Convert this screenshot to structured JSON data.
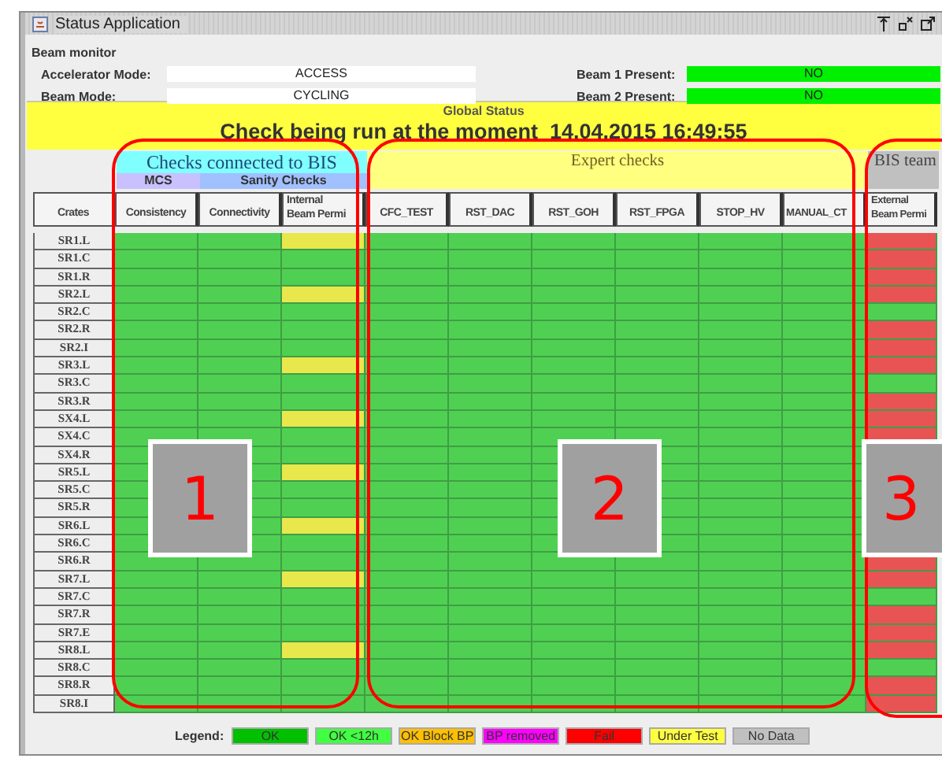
{
  "window": {
    "title": "Status Application"
  },
  "beam_monitor": {
    "title": "Beam monitor",
    "fields": [
      {
        "label": "Accelerator Mode:",
        "value": "ACCESS",
        "kind": "text"
      },
      {
        "label": "Beam Mode:",
        "value": "CYCLING",
        "kind": "text"
      },
      {
        "label": "Beam 1 Present:",
        "value": "NO",
        "kind": "indicator",
        "color": "#00f000"
      },
      {
        "label": "Beam 2 Present:",
        "value": "NO",
        "kind": "indicator",
        "color": "#00f000"
      }
    ]
  },
  "global_status": {
    "title": "Global Status",
    "message": "Check being run at the moment  14.04.2015 16:49:55"
  },
  "table": {
    "groups": [
      {
        "label": "Checks connected to BIS",
        "kind": "bis",
        "subgroups": [
          "MCS",
          "Sanity  Checks"
        ]
      },
      {
        "label": "Expert  checks",
        "kind": "expert"
      },
      {
        "label": "BIS team",
        "kind": "team"
      }
    ],
    "columns": [
      "Crates",
      "Consistency",
      "Connectivity",
      "Internal\nBeam Permi",
      "CFC_TEST",
      "RST_DAC",
      "RST_GOH",
      "RST_FPGA",
      "STOP_HV",
      "MANUAL_CT",
      "External\nBeam Permi"
    ],
    "rows": [
      {
        "crate": "SR1.L",
        "cells": [
          {
            "color": "#50d052"
          },
          {
            "color": "#50d052"
          },
          {
            "color": "#e8e84c"
          },
          {
            "color": "#50d052"
          },
          {
            "color": "#50d052"
          },
          {
            "color": "#50d052"
          },
          {
            "color": "#50d052"
          },
          {
            "color": "#50d052"
          },
          {
            "color": "#50d052"
          },
          {
            "color": "#e85454"
          }
        ]
      },
      {
        "crate": "SR1.C",
        "cells": [
          {
            "color": "#50d052"
          },
          {
            "color": "#50d052"
          },
          {
            "color": "#50d052"
          },
          {
            "color": "#50d052"
          },
          {
            "color": "#50d052"
          },
          {
            "color": "#50d052"
          },
          {
            "color": "#50d052"
          },
          {
            "color": "#50d052"
          },
          {
            "color": "#50d052"
          },
          {
            "color": "#e85454"
          }
        ]
      },
      {
        "crate": "SR1.R",
        "cells": [
          {
            "color": "#50d052"
          },
          {
            "color": "#50d052"
          },
          {
            "color": "#50d052"
          },
          {
            "color": "#50d052"
          },
          {
            "color": "#50d052"
          },
          {
            "color": "#50d052"
          },
          {
            "color": "#50d052"
          },
          {
            "color": "#50d052"
          },
          {
            "color": "#50d052"
          },
          {
            "color": "#e85454"
          }
        ]
      },
      {
        "crate": "SR2.L",
        "cells": [
          {
            "color": "#50d052"
          },
          {
            "color": "#50d052"
          },
          {
            "color": "#e8e84c"
          },
          {
            "color": "#50d052"
          },
          {
            "color": "#50d052"
          },
          {
            "color": "#50d052"
          },
          {
            "color": "#50d052"
          },
          {
            "color": "#50d052"
          },
          {
            "color": "#50d052"
          },
          {
            "color": "#e85454"
          }
        ]
      },
      {
        "crate": "SR2.C",
        "cells": [
          {
            "color": "#50d052"
          },
          {
            "color": "#50d052"
          },
          {
            "color": "#50d052"
          },
          {
            "color": "#50d052"
          },
          {
            "color": "#50d052"
          },
          {
            "color": "#50d052"
          },
          {
            "color": "#50d052"
          },
          {
            "color": "#50d052"
          },
          {
            "color": "#50d052"
          },
          {
            "color": "#50d052"
          }
        ]
      },
      {
        "crate": "SR2.R",
        "cells": [
          {
            "color": "#50d052"
          },
          {
            "color": "#50d052"
          },
          {
            "color": "#50d052"
          },
          {
            "color": "#50d052"
          },
          {
            "color": "#50d052"
          },
          {
            "color": "#50d052"
          },
          {
            "color": "#50d052"
          },
          {
            "color": "#50d052"
          },
          {
            "color": "#50d052"
          },
          {
            "color": "#e85454"
          }
        ]
      },
      {
        "crate": "SR2.I",
        "cells": [
          {
            "color": "#50d052"
          },
          {
            "color": "#50d052"
          },
          {
            "color": "#50d052"
          },
          {
            "color": "#50d052"
          },
          {
            "color": "#50d052"
          },
          {
            "color": "#50d052"
          },
          {
            "color": "#50d052"
          },
          {
            "color": "#50d052"
          },
          {
            "color": "#50d052"
          },
          {
            "color": "#e85454"
          }
        ]
      },
      {
        "crate": "SR3.L",
        "cells": [
          {
            "color": "#50d052"
          },
          {
            "color": "#50d052"
          },
          {
            "color": "#e8e84c"
          },
          {
            "color": "#50d052"
          },
          {
            "color": "#50d052"
          },
          {
            "color": "#50d052"
          },
          {
            "color": "#50d052"
          },
          {
            "color": "#50d052"
          },
          {
            "color": "#50d052"
          },
          {
            "color": "#e85454"
          }
        ]
      },
      {
        "crate": "SR3.C",
        "cells": [
          {
            "color": "#50d052"
          },
          {
            "color": "#50d052"
          },
          {
            "color": "#50d052"
          },
          {
            "color": "#50d052"
          },
          {
            "color": "#50d052"
          },
          {
            "color": "#50d052"
          },
          {
            "color": "#50d052"
          },
          {
            "color": "#50d052"
          },
          {
            "color": "#50d052"
          },
          {
            "color": "#50d052"
          }
        ]
      },
      {
        "crate": "SR3.R",
        "cells": [
          {
            "color": "#50d052"
          },
          {
            "color": "#50d052"
          },
          {
            "color": "#50d052"
          },
          {
            "color": "#50d052"
          },
          {
            "color": "#50d052"
          },
          {
            "color": "#50d052"
          },
          {
            "color": "#50d052"
          },
          {
            "color": "#50d052"
          },
          {
            "color": "#50d052"
          },
          {
            "color": "#e85454"
          }
        ]
      },
      {
        "crate": "SX4.L",
        "cells": [
          {
            "color": "#50d052"
          },
          {
            "color": "#50d052"
          },
          {
            "color": "#e8e84c"
          },
          {
            "color": "#50d052"
          },
          {
            "color": "#50d052"
          },
          {
            "color": "#50d052"
          },
          {
            "color": "#50d052"
          },
          {
            "color": "#50d052"
          },
          {
            "color": "#50d052"
          },
          {
            "color": "#e85454"
          }
        ]
      },
      {
        "crate": "SX4.C",
        "cells": [
          {
            "color": "#50d052"
          },
          {
            "color": "#50d052"
          },
          {
            "color": "#50d052"
          },
          {
            "color": "#50d052"
          },
          {
            "color": "#50d052"
          },
          {
            "color": "#50d052"
          },
          {
            "color": "#50d052"
          },
          {
            "color": "#50d052"
          },
          {
            "color": "#50d052"
          },
          {
            "color": "#e85454"
          }
        ]
      },
      {
        "crate": "SX4.R",
        "cells": [
          {
            "color": "#50d052"
          },
          {
            "color": "#50d052"
          },
          {
            "color": "#50d052"
          },
          {
            "color": "#50d052"
          },
          {
            "color": "#50d052"
          },
          {
            "color": "#50d052"
          },
          {
            "color": "#50d052"
          },
          {
            "color": "#50d052"
          },
          {
            "color": "#50d052"
          },
          null
        ]
      },
      {
        "crate": "SR5.L",
        "cells": [
          {
            "color": "#50d052"
          },
          {
            "color": "#50d052"
          },
          {
            "color": "#e8e84c"
          },
          {
            "color": "#50d052"
          },
          {
            "color": "#50d052"
          },
          {
            "color": "#50d052"
          },
          {
            "color": "#50d052"
          },
          {
            "color": "#50d052"
          },
          {
            "color": "#50d052"
          },
          null
        ]
      },
      {
        "crate": "SR5.C",
        "cells": [
          {
            "color": "#50d052"
          },
          {
            "color": "#50d052"
          },
          {
            "color": "#50d052"
          },
          {
            "color": "#50d052"
          },
          {
            "color": "#50d052"
          },
          {
            "color": "#50d052"
          },
          {
            "color": "#50d052"
          },
          {
            "color": "#50d052"
          },
          {
            "color": "#50d052"
          },
          null
        ]
      },
      {
        "crate": "SR5.R",
        "cells": [
          {
            "color": "#50d052"
          },
          {
            "color": "#50d052"
          },
          {
            "color": "#50d052"
          },
          {
            "color": "#50d052"
          },
          {
            "color": "#50d052"
          },
          {
            "color": "#50d052"
          },
          {
            "color": "#50d052"
          },
          {
            "color": "#50d052"
          },
          {
            "color": "#50d052"
          },
          null
        ]
      },
      {
        "crate": "SR6.L",
        "cells": [
          {
            "color": "#50d052"
          },
          {
            "color": "#50d052"
          },
          {
            "color": "#e8e84c"
          },
          {
            "color": "#50d052"
          },
          {
            "color": "#50d052"
          },
          {
            "color": "#50d052"
          },
          {
            "color": "#50d052"
          },
          {
            "color": "#50d052"
          },
          {
            "color": "#50d052"
          },
          null
        ]
      },
      {
        "crate": "SR6.C",
        "cells": [
          {
            "color": "#50d052"
          },
          {
            "color": "#50d052"
          },
          {
            "color": "#50d052"
          },
          {
            "color": "#50d052"
          },
          {
            "color": "#50d052"
          },
          {
            "color": "#50d052"
          },
          {
            "color": "#50d052"
          },
          {
            "color": "#50d052"
          },
          {
            "color": "#50d052"
          },
          null
        ]
      },
      {
        "crate": "SR6.R",
        "cells": [
          {
            "color": "#50d052"
          },
          {
            "color": "#50d052"
          },
          {
            "color": "#50d052"
          },
          {
            "color": "#50d052"
          },
          {
            "color": "#50d052"
          },
          {
            "color": "#50d052"
          },
          {
            "color": "#50d052"
          },
          {
            "color": "#50d052"
          },
          {
            "color": "#50d052"
          },
          {
            "color": "#e85454"
          }
        ]
      },
      {
        "crate": "SR7.L",
        "cells": [
          {
            "color": "#50d052"
          },
          {
            "color": "#50d052"
          },
          {
            "color": "#e8e84c"
          },
          {
            "color": "#50d052"
          },
          {
            "color": "#50d052"
          },
          {
            "color": "#50d052"
          },
          {
            "color": "#50d052"
          },
          {
            "color": "#50d052"
          },
          {
            "color": "#50d052"
          },
          {
            "color": "#e85454"
          }
        ]
      },
      {
        "crate": "SR7.C",
        "cells": [
          {
            "color": "#50d052"
          },
          {
            "color": "#50d052"
          },
          {
            "color": "#50d052"
          },
          {
            "color": "#50d052"
          },
          {
            "color": "#50d052"
          },
          {
            "color": "#50d052"
          },
          {
            "color": "#50d052"
          },
          {
            "color": "#50d052"
          },
          {
            "color": "#50d052"
          },
          {
            "color": "#50d052"
          }
        ]
      },
      {
        "crate": "SR7.R",
        "cells": [
          {
            "color": "#50d052"
          },
          {
            "color": "#50d052"
          },
          {
            "color": "#50d052"
          },
          {
            "color": "#50d052"
          },
          {
            "color": "#50d052"
          },
          {
            "color": "#50d052"
          },
          {
            "color": "#50d052"
          },
          {
            "color": "#50d052"
          },
          {
            "color": "#50d052"
          },
          {
            "color": "#e85454"
          }
        ]
      },
      {
        "crate": "SR7.E",
        "cells": [
          {
            "color": "#50d052"
          },
          {
            "color": "#50d052"
          },
          {
            "color": "#50d052"
          },
          {
            "color": "#50d052"
          },
          {
            "color": "#50d052"
          },
          {
            "color": "#50d052"
          },
          {
            "color": "#50d052"
          },
          {
            "color": "#50d052"
          },
          {
            "color": "#50d052"
          },
          {
            "color": "#e85454"
          }
        ]
      },
      {
        "crate": "SR8.L",
        "cells": [
          {
            "color": "#50d052"
          },
          {
            "color": "#50d052"
          },
          {
            "color": "#e8e84c"
          },
          {
            "color": "#50d052"
          },
          {
            "color": "#50d052"
          },
          {
            "color": "#50d052"
          },
          {
            "color": "#50d052"
          },
          {
            "color": "#50d052"
          },
          {
            "color": "#50d052"
          },
          {
            "color": "#e85454"
          }
        ]
      },
      {
        "crate": "SR8.C",
        "cells": [
          {
            "color": "#50d052"
          },
          {
            "color": "#50d052"
          },
          {
            "color": "#50d052"
          },
          {
            "color": "#50d052"
          },
          {
            "color": "#50d052"
          },
          {
            "color": "#50d052"
          },
          {
            "color": "#50d052"
          },
          {
            "color": "#50d052"
          },
          {
            "color": "#50d052"
          },
          {
            "color": "#50d052"
          }
        ]
      },
      {
        "crate": "SR8.R",
        "cells": [
          {
            "color": "#50d052"
          },
          {
            "color": "#50d052"
          },
          {
            "color": "#50d052"
          },
          {
            "color": "#50d052"
          },
          {
            "color": "#50d052"
          },
          {
            "color": "#50d052"
          },
          {
            "color": "#50d052"
          },
          {
            "color": "#50d052"
          },
          {
            "color": "#50d052"
          },
          {
            "color": "#e85454"
          }
        ]
      },
      {
        "crate": "SR8.I",
        "cells": [
          {
            "color": "#50d052"
          },
          {
            "color": "#50d052"
          },
          {
            "color": "#50d052"
          },
          {
            "color": "#50d052"
          },
          {
            "color": "#50d052"
          },
          {
            "color": "#50d052"
          },
          {
            "color": "#50d052"
          },
          {
            "color": "#50d052"
          },
          {
            "color": "#50d052"
          },
          {
            "color": "#e85454"
          }
        ]
      }
    ]
  },
  "legend": {
    "label": "Legend:",
    "items": [
      {
        "label": "OK",
        "color": "#00c000"
      },
      {
        "label": "OK <12h",
        "color": "#40ff40"
      },
      {
        "label": "OK Block BP",
        "color": "#ffc000"
      },
      {
        "label": "BP removed",
        "color": "#ff00ff"
      },
      {
        "label": "Fail",
        "color": "#ff0000"
      },
      {
        "label": "Under Test",
        "color": "#ffff40"
      },
      {
        "label": "No Data",
        "color": "#c0c0c0"
      }
    ]
  },
  "annotations": [
    {
      "label": "1"
    },
    {
      "label": "2"
    },
    {
      "label": "3"
    }
  ]
}
